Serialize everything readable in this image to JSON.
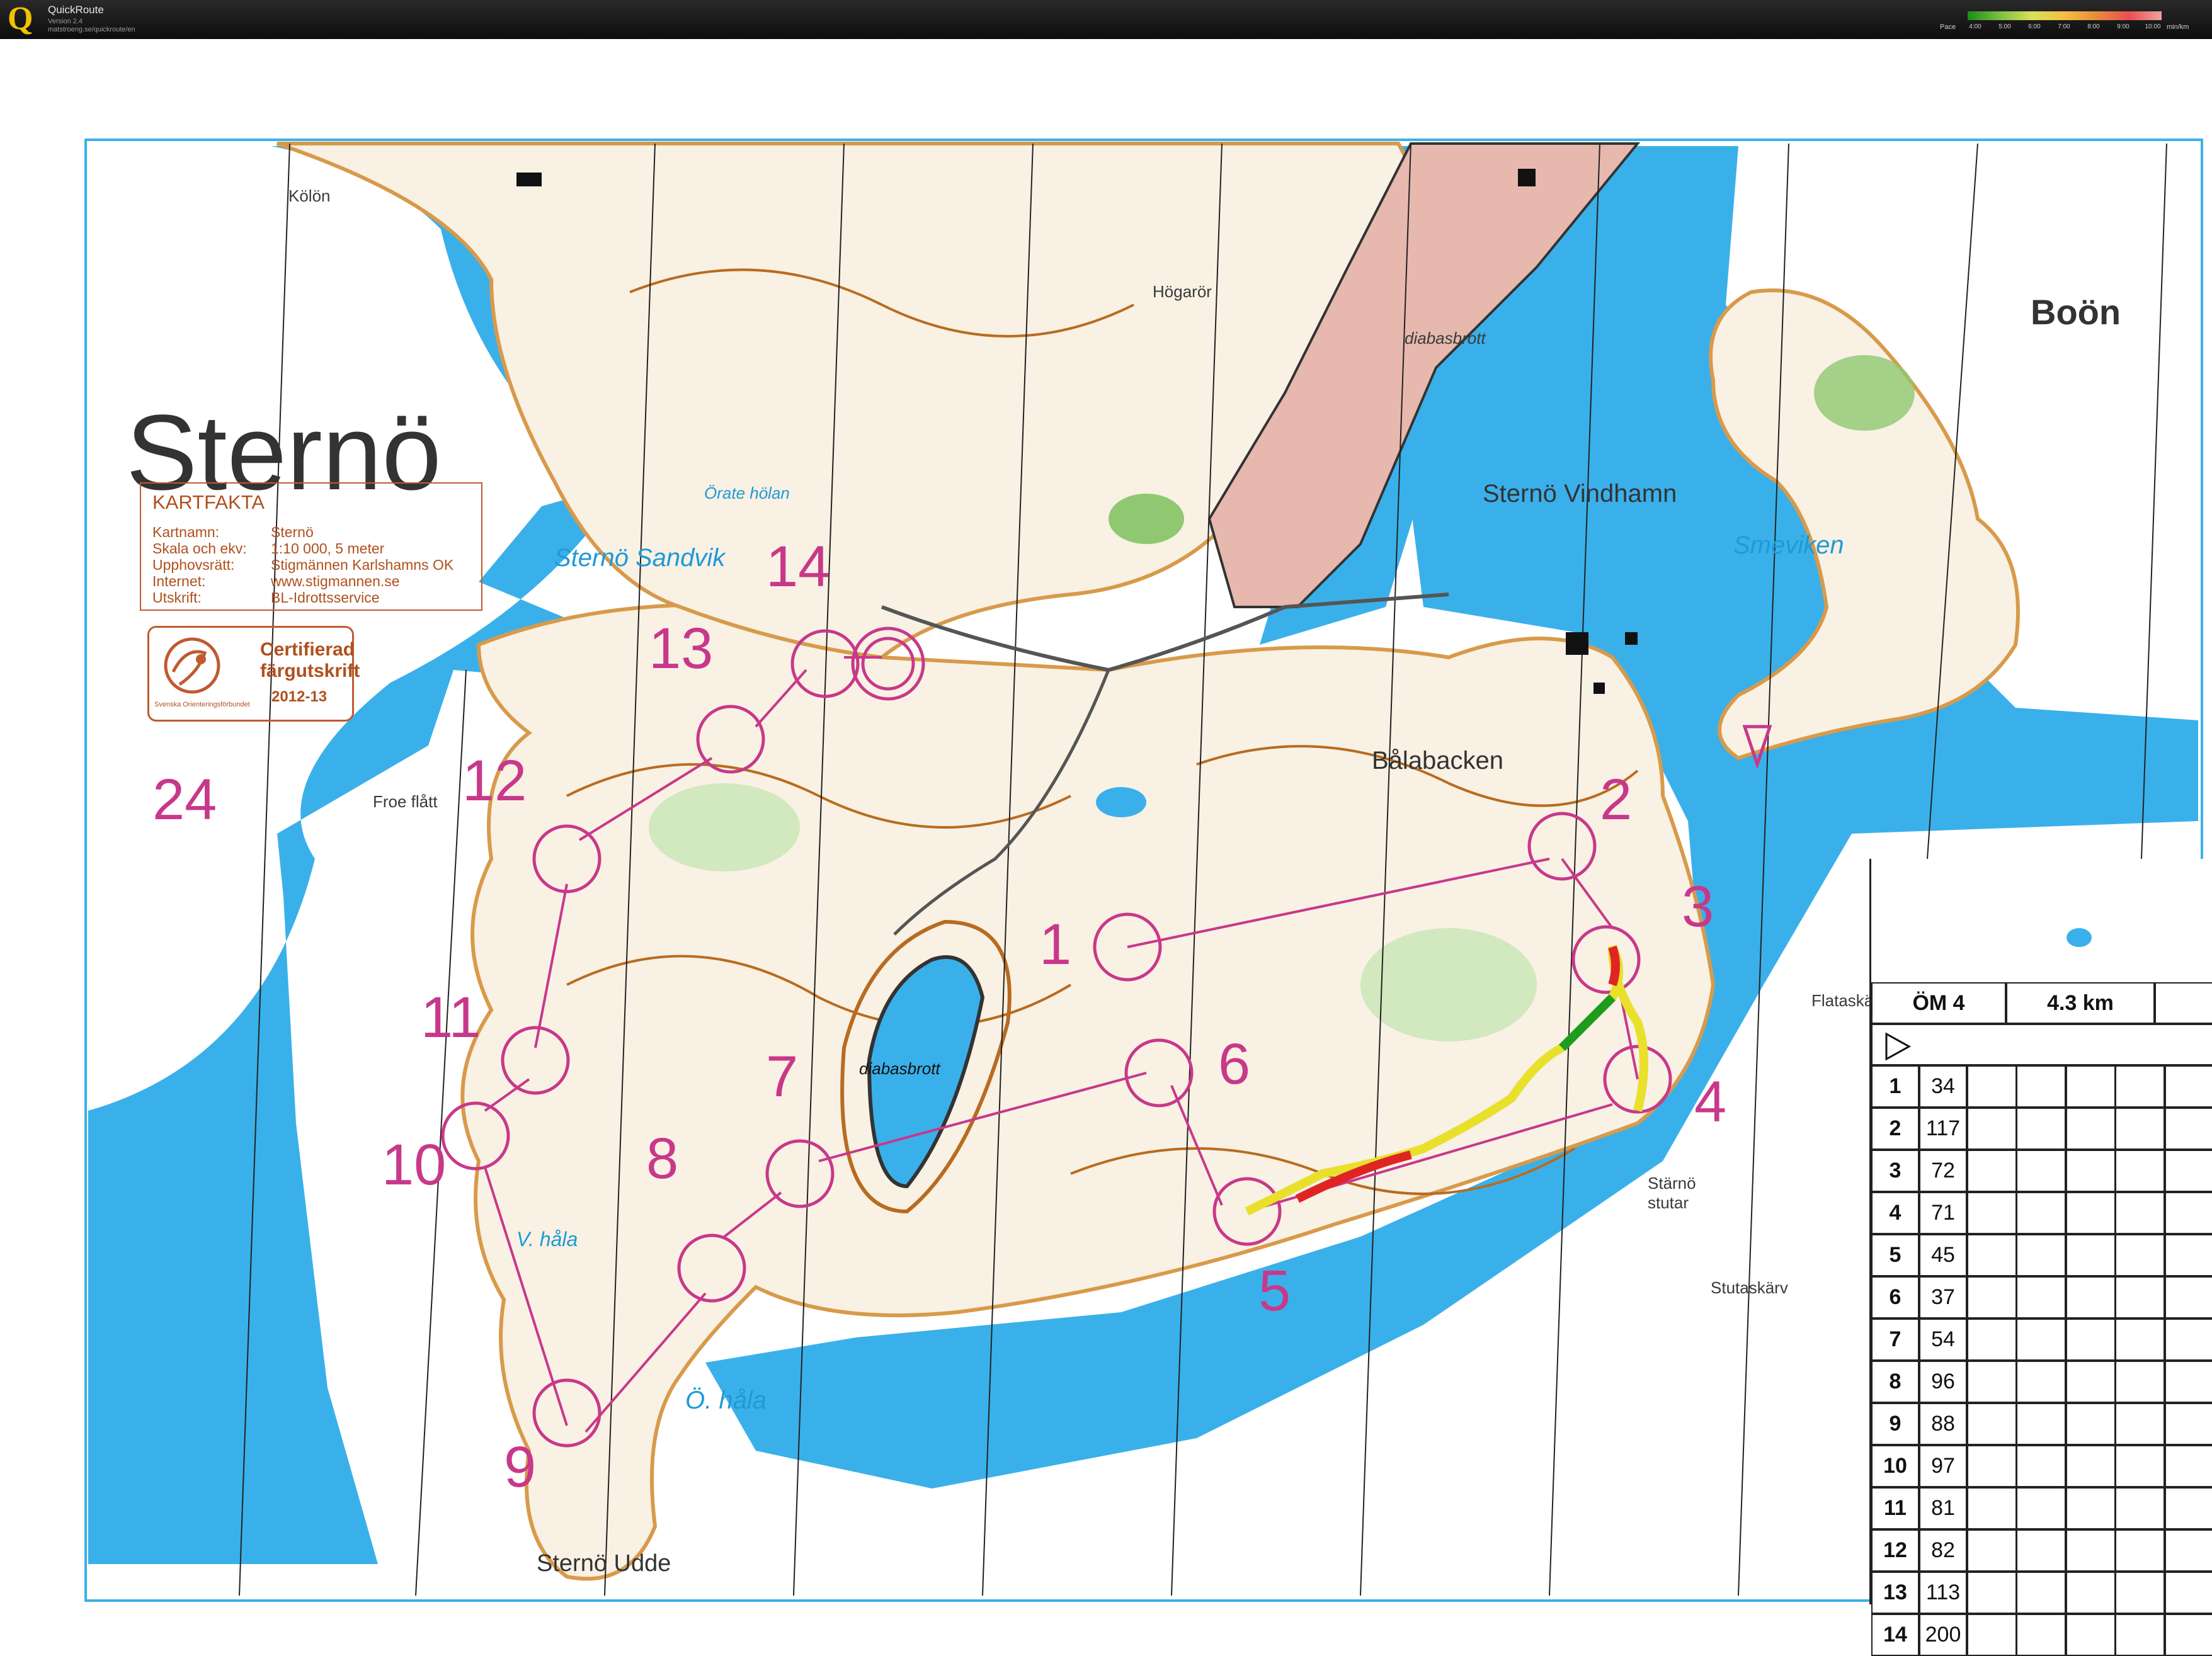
{
  "app": {
    "logo": "Q",
    "title": "QuickRoute",
    "version": "Version 2.4",
    "url": "matstroeng.se/quickroute/en",
    "pace_label": "Pace",
    "pace_ticks": [
      "4:00",
      "5:00",
      "6:00",
      "7:00",
      "8:00",
      "9:00",
      "10:00"
    ],
    "pace_unit": "min/km"
  },
  "map": {
    "title": "Sternö",
    "colors": {
      "water": "#3ab0ea",
      "land": "#f8f1e4",
      "contour": "#b96b1f",
      "pink": "#c8388a",
      "quarry": "#e6b8ae",
      "green": "#8fc870",
      "route_good": "#1e9c1e",
      "route_mid": "#e8e02a",
      "route_slow": "#e02424"
    },
    "place_names": [
      "Kölön",
      "Högarör",
      "diabasbrott",
      "Boön",
      "Sternö Vindhamn",
      "Smeviken",
      "Örate hölan",
      "Sternö Sandvik",
      "Bålabacken",
      "Froe flått",
      "diabasbrott",
      "Flataskä",
      "Stärnö stutar",
      "Stutaskärv",
      "Ö. håla",
      "V. håla",
      "Sternö Udde"
    ],
    "controls": [
      "1",
      "2",
      "3",
      "4",
      "5",
      "6",
      "7",
      "8",
      "9",
      "10",
      "11",
      "12",
      "13",
      "14"
    ],
    "sheet_number": "24"
  },
  "kartfakta": {
    "title": "KARTFAKTA",
    "rows": [
      {
        "k": "Kartnamn:",
        "v": "Sternö"
      },
      {
        "k": "Skala och ekv:",
        "v": "1:10 000, 5 meter"
      },
      {
        "k": "Upphovsrätt:",
        "v": "Stigmännen Karlshamns OK"
      },
      {
        "k": "Internet:",
        "v": "www.stigmannen.se"
      },
      {
        "k": "Utskrift:",
        "v": "BL-Idrottsservice"
      }
    ]
  },
  "certificate": {
    "line1": "Certifierad",
    "line2": "färgutskrift",
    "year": "2012-13",
    "org": "Svenska Orienteringsförbundet"
  },
  "description": {
    "course": "ÖM 4",
    "length": "4.3 km",
    "rows": [
      {
        "num": "1",
        "code": "34"
      },
      {
        "num": "2",
        "code": "117"
      },
      {
        "num": "3",
        "code": "72"
      },
      {
        "num": "4",
        "code": "71"
      },
      {
        "num": "5",
        "code": "45"
      },
      {
        "num": "6",
        "code": "37"
      },
      {
        "num": "7",
        "code": "54"
      },
      {
        "num": "8",
        "code": "96"
      },
      {
        "num": "9",
        "code": "88"
      },
      {
        "num": "10",
        "code": "97"
      },
      {
        "num": "11",
        "code": "81"
      },
      {
        "num": "12",
        "code": "82"
      },
      {
        "num": "13",
        "code": "113"
      },
      {
        "num": "14",
        "code": "200"
      }
    ]
  }
}
